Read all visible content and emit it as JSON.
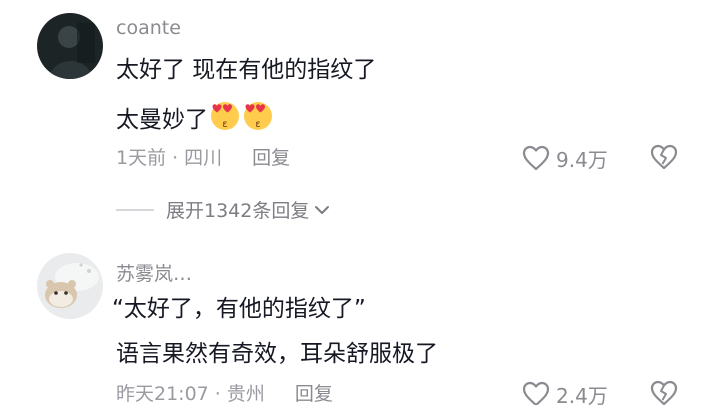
{
  "comments": [
    {
      "username": "coante",
      "lines": [
        "太好了 现在有他的指纹了",
        "太曼妙了"
      ],
      "emoji": "heart-eyes-face",
      "time": "1天前",
      "location": "四川",
      "reply_label": "回复",
      "likes": "9.4万"
    },
    {
      "username": "苏雾岚…",
      "lines": [
        "“太好了，有他的指纹了”",
        "语言果然有奇效，耳朵舒服极了"
      ],
      "time": "昨天21:07",
      "location": "贵州",
      "reply_label": "回复",
      "likes": "2.4万"
    }
  ],
  "expand_replies": {
    "label": "展开1342条回复"
  },
  "separator": "·",
  "colors": {
    "text_primary": "#161823",
    "text_secondary": "#8a8b91",
    "background": "#ffffff"
  }
}
